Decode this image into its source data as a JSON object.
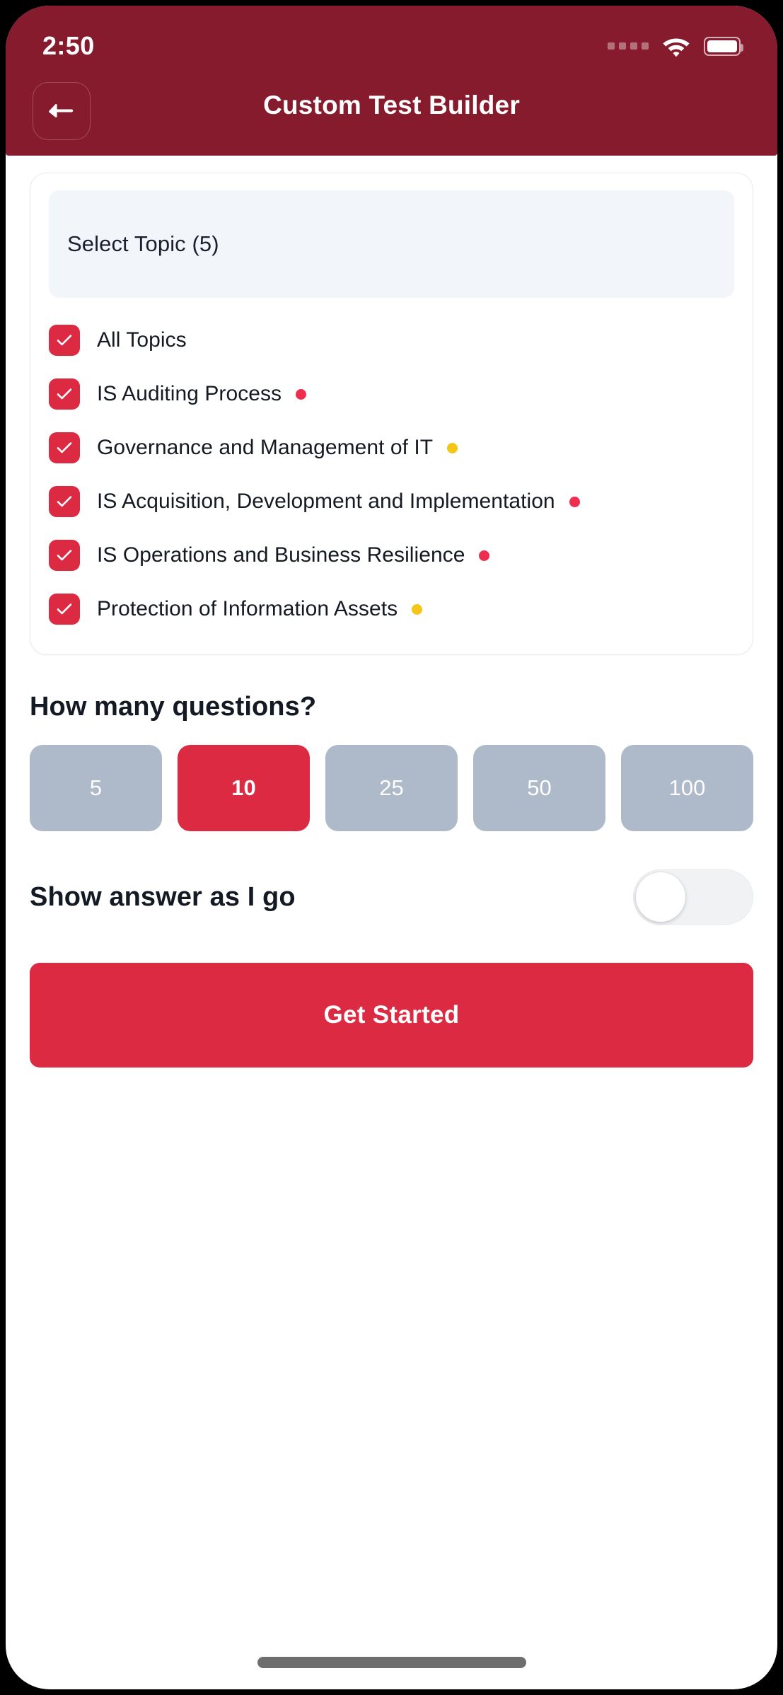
{
  "status_bar": {
    "time": "2:50",
    "signal_icon": "signal-dots-icon",
    "wifi_icon": "wifi-icon",
    "battery_icon": "battery-full-icon"
  },
  "header": {
    "title": "Custom Test Builder",
    "back_icon": "arrow-left-icon",
    "background_color": "#861B2D"
  },
  "topics_card": {
    "select_field_label": "Select Topic (5)",
    "items": [
      {
        "label": "All Topics",
        "checked": true,
        "dot_color": null
      },
      {
        "label": "IS Auditing Process",
        "checked": true,
        "dot_color": "#EE2E4E"
      },
      {
        "label": "Governance and Management of IT",
        "checked": true,
        "dot_color": "#F5C518"
      },
      {
        "label": "IS Acquisition, Development and Implementation",
        "checked": true,
        "dot_color": "#EE2E4E"
      },
      {
        "label": "IS Operations and Business Resilience",
        "checked": true,
        "dot_color": "#EE2E4E"
      },
      {
        "label": "Protection of Information Assets",
        "checked": true,
        "dot_color": "#F5C518"
      }
    ]
  },
  "questions_section": {
    "heading": "How many questions?",
    "options": [
      {
        "label": "5",
        "selected": false
      },
      {
        "label": "10",
        "selected": true
      },
      {
        "label": "25",
        "selected": false
      },
      {
        "label": "50",
        "selected": false
      },
      {
        "label": "100",
        "selected": false
      }
    ]
  },
  "answer_toggle": {
    "label": "Show answer as I go",
    "enabled": false
  },
  "cta": {
    "label": "Get Started"
  },
  "colors": {
    "accent_red": "#DC2A43",
    "header_maroon": "#861B2D",
    "inactive_gray": "#AEB9C9",
    "field_background": "#F2F5FA",
    "warning_yellow": "#F5C518"
  }
}
